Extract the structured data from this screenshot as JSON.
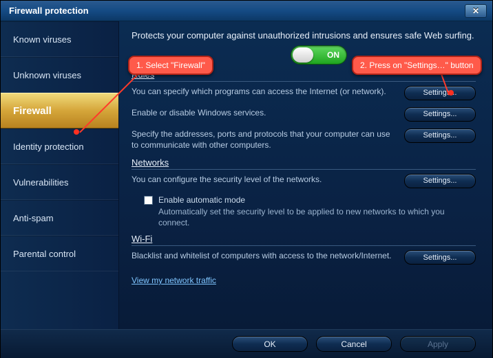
{
  "title": "Firewall protection",
  "close_glyph": "✕",
  "sidebar": {
    "items": [
      {
        "label": "Known viruses"
      },
      {
        "label": "Unknown viruses"
      },
      {
        "label": "Firewall"
      },
      {
        "label": "Identity protection"
      },
      {
        "label": "Vulnerabilities"
      },
      {
        "label": "Anti-spam"
      },
      {
        "label": "Parental control"
      }
    ],
    "active_index": 2
  },
  "content": {
    "intro": "Protects your computer against unauthorized intrusions and ensures safe Web surfing.",
    "toggle_state": "ON",
    "sections": {
      "rules": {
        "heading": "Rules",
        "rows": [
          {
            "desc": "You can specify which programs can access the Internet (or network).",
            "btn": "Settings..."
          },
          {
            "desc": "Enable or disable Windows services.",
            "btn": "Settings..."
          },
          {
            "desc": "Specify the addresses, ports and protocols that your computer can use to communicate with other computers.",
            "btn": "Settings..."
          }
        ]
      },
      "networks": {
        "heading": "Networks",
        "row": {
          "desc": "You can configure the security level of the networks.",
          "btn": "Settings..."
        },
        "checkbox_label": "Enable automatic mode",
        "checkbox_sub": "Automatically set the security level to be applied to new networks to which you connect."
      },
      "wifi": {
        "heading": "Wi-Fi",
        "row": {
          "desc": "Blacklist and whitelist of computers with access to the network/Internet.",
          "btn": "Settings..."
        },
        "link": "View my network traffic"
      }
    }
  },
  "footer": {
    "ok": "OK",
    "cancel": "Cancel",
    "apply": "Apply"
  },
  "annotations": {
    "a1": "1. Select \"Firewall\"",
    "a2": "2. Press on \"Settings…\" button"
  }
}
